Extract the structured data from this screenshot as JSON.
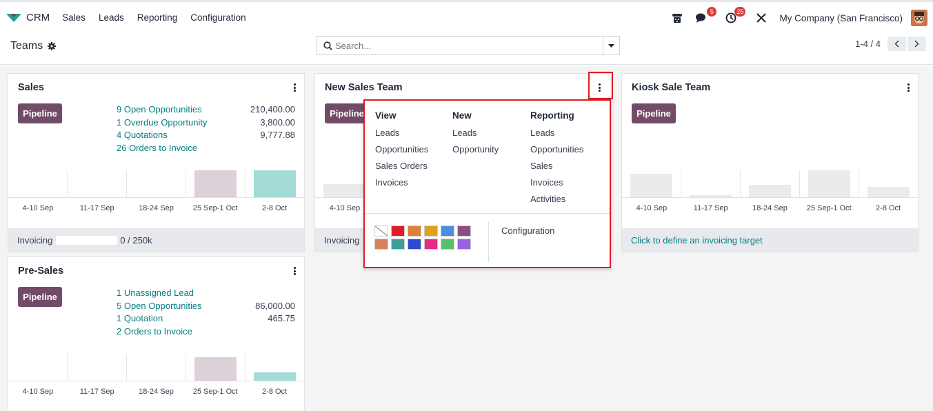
{
  "navbar": {
    "app_name": "CRM",
    "menu": [
      "Sales",
      "Leads",
      "Reporting",
      "Configuration"
    ],
    "messages_count": "5",
    "activities_count": "25",
    "company": "My Company (San Francisco)"
  },
  "control_panel": {
    "title": "Teams",
    "search_placeholder": "Search...",
    "pager": "1-4 / 4"
  },
  "colors": {
    "brand": "#714b67",
    "link": "#017e84",
    "highlight": "#e01b24"
  },
  "week_labels": [
    "4-10 Sep",
    "11-17 Sep",
    "18-24 Sep",
    "25 Sep-1 Oct",
    "2-8 Oct"
  ],
  "cards": {
    "sales": {
      "title": "Sales",
      "pipeline_label": "Pipeline",
      "stats": [
        {
          "label": "9 Open Opportunities",
          "value": "210,400.00"
        },
        {
          "label": "1 Overdue Opportunity",
          "value": "3,800.00"
        },
        {
          "label": "4 Quotations",
          "value": "9,777.88"
        },
        {
          "label": "26 Orders to Invoice",
          "value": ""
        }
      ],
      "invoicing_label": "Invoicing",
      "invoicing_value": "0 /  250k",
      "invoicing_progress": 0
    },
    "new_sales_team": {
      "title": "New Sales Team",
      "pipeline_label": "Pipeline",
      "invoicing_label": "Invoicing"
    },
    "kiosk": {
      "title": "Kiosk Sale Team",
      "pipeline_label": "Pipeline",
      "invoicing_link": "Click to define an invoicing target"
    },
    "presales": {
      "title": "Pre-Sales",
      "pipeline_label": "Pipeline",
      "stats": [
        {
          "label": "1 Unassigned Lead",
          "value": ""
        },
        {
          "label": "5 Open Opportunities",
          "value": "86,000.00"
        },
        {
          "label": "1 Quotation",
          "value": "465.75"
        },
        {
          "label": "2 Orders to Invoice",
          "value": ""
        }
      ]
    }
  },
  "dropdown": {
    "view": {
      "title": "View",
      "items": [
        "Leads",
        "Opportunities",
        "Sales Orders",
        "Invoices"
      ]
    },
    "new": {
      "title": "New",
      "items": [
        "Leads",
        "Opportunity"
      ]
    },
    "reporting": {
      "title": "Reporting",
      "items": [
        "Leads",
        "Opportunities",
        "Sales",
        "Invoices",
        "Activities"
      ]
    },
    "configuration": "Configuration",
    "swatches": [
      "none",
      "#e8182b",
      "#e07f3b",
      "#e0a21c",
      "#4a8fdb",
      "#8f4e82",
      "#d8825e",
      "#3c9f98",
      "#2b4bd1",
      "#e52b80",
      "#58bf6a",
      "#9b61e0"
    ]
  }
}
